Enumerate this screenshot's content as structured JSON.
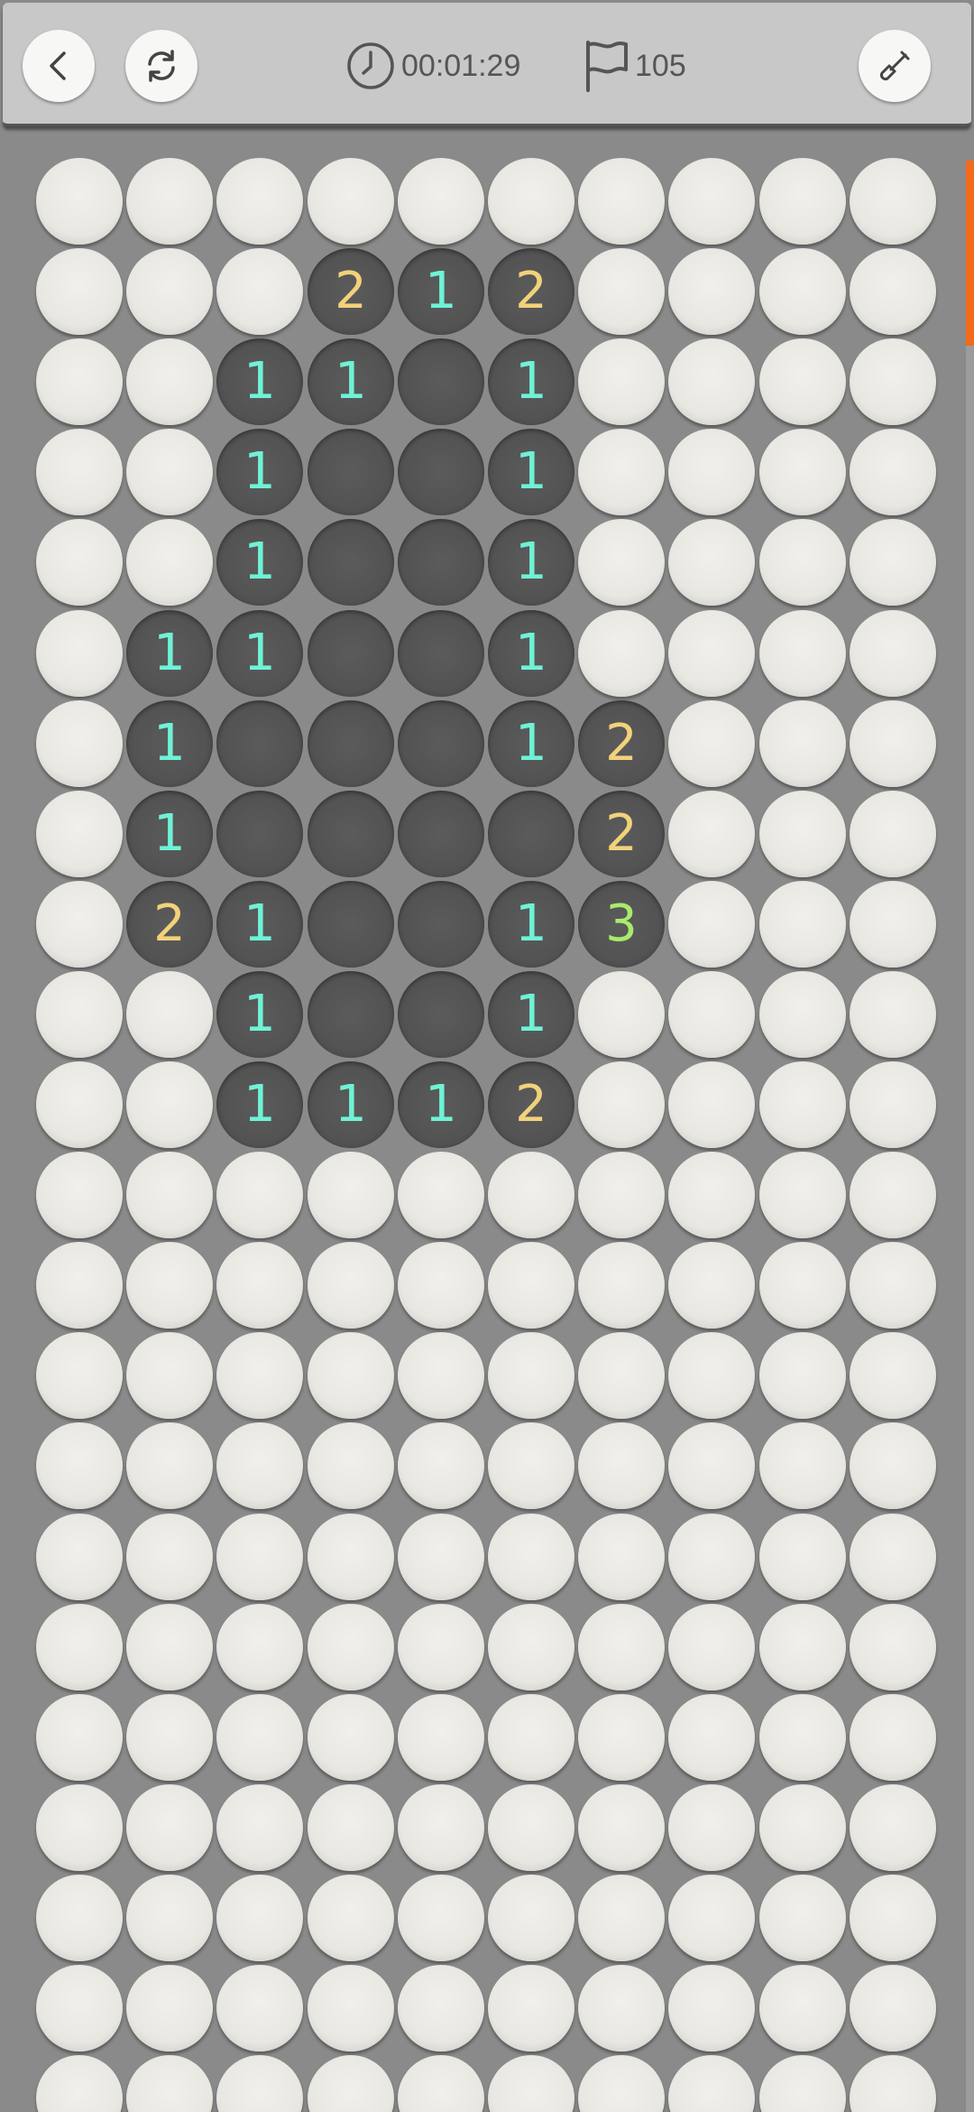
{
  "toolbar": {
    "back_icon": "chevron-left-icon",
    "restart_icon": "refresh-icon",
    "timer_icon": "clock-icon",
    "timer": "00:01:29",
    "flag_icon": "flag-icon",
    "flag_count": "105",
    "dig_icon": "shovel-icon"
  },
  "colors": {
    "n1": "#6ff2d6",
    "n2": "#f2d27a",
    "n3": "#a7ec6b",
    "scroll_accent": "#f26a1c"
  },
  "board": {
    "columns": 10,
    "legend": "H = hidden, E = empty revealed, digit = revealed number",
    "rows": [
      "HHHHHHHHHH",
      "HHH212HHHH",
      "HH11E1HHHH",
      "HH1EE1HHHH",
      "HH1EE1HHHH",
      "H11EE1HHHH",
      "H1EEE12HHH",
      "H1EEEE2HHH",
      "H21EE13HHH",
      "HH1EE1HHHH",
      "HH1112HHHH",
      "HHHHHHHHHH",
      "HHHHHHHHHH",
      "HHHHHHHHHH",
      "HHHHHHHHHH",
      "HHHHHHHHHH",
      "HHHHHHHHHH",
      "HHHHHHHHHH",
      "HHHHHHHHHH",
      "HHHHHHHHHH",
      "HHHHHHHHHH",
      "HHHHHHHHHH"
    ]
  }
}
